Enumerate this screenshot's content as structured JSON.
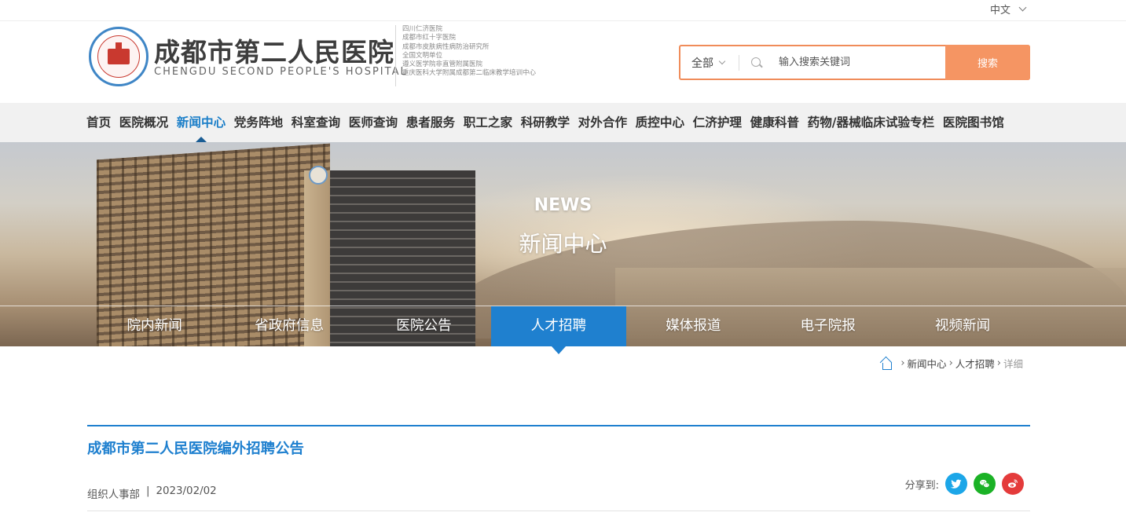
{
  "lang": {
    "label": "中文"
  },
  "logo": {
    "title": "成都市第二人民医院",
    "english": "CHENGDU SECOND PEOPLE'S HOSPITAL",
    "affiliations": [
      "四川仁济医院",
      "成都市红十字医院",
      "成都市皮肤病性病防治研究所",
      "全国文明单位",
      "遵义医学院非直管附属医院",
      "重庆医科大学附属成都第二临床教学培训中心"
    ]
  },
  "search": {
    "scope": "全部",
    "placeholder": "输入搜索关键词",
    "button": "搜索"
  },
  "main_nav": {
    "items": [
      "首页",
      "医院概况",
      "新闻中心",
      "党务阵地",
      "科室查询",
      "医师查询",
      "患者服务",
      "职工之家",
      "科研教学",
      "对外合作",
      "质控中心",
      "仁济护理",
      "健康科普",
      "药物/器械临床试验专栏",
      "医院图书馆"
    ],
    "active": "新闻中心"
  },
  "banner": {
    "title_en": "NEWS",
    "title_cn": "新闻中心"
  },
  "sub_nav": {
    "items": [
      "院内新闻",
      "省政府信息",
      "医院公告",
      "人才招聘",
      "媒体报道",
      "电子院报",
      "视频新闻"
    ],
    "active": "人才招聘"
  },
  "breadcrumb": {
    "items": [
      "新闻中心",
      "人才招聘"
    ],
    "current": "详细"
  },
  "article": {
    "title": "成都市第二人民医院编外招聘公告",
    "department": "组织人事部",
    "separator": "|",
    "date": "2023/02/02"
  },
  "share": {
    "label": "分享到:",
    "icons": [
      "twitter-icon",
      "wechat-icon",
      "weibo-icon"
    ]
  },
  "colors": {
    "accent_blue": "#1f80cf",
    "search_orange": "#f59563",
    "nav_background": "#f1f1f1"
  }
}
